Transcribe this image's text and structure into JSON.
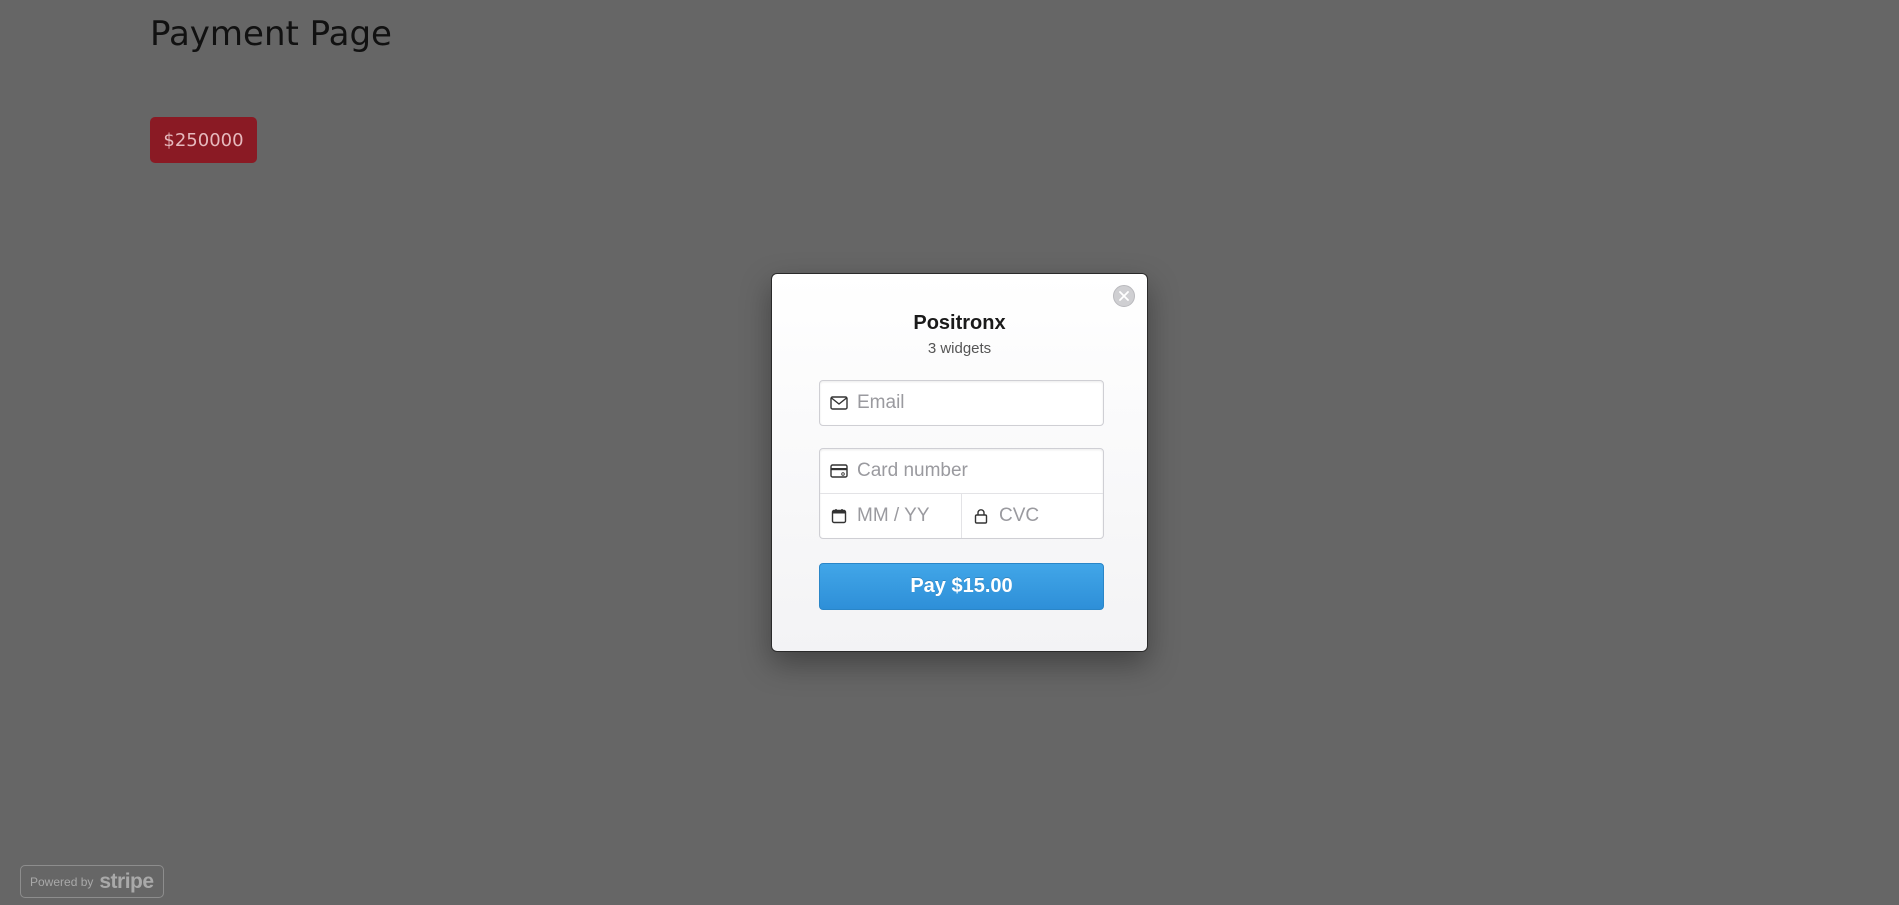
{
  "page": {
    "title": "Payment Page",
    "price_button_label": "$250000"
  },
  "checkout": {
    "merchant_name": "Positronx",
    "description": "3 widgets",
    "email_placeholder": "Email",
    "card_number_placeholder": "Card number",
    "expiry_placeholder": "MM / YY",
    "cvc_placeholder": "CVC",
    "pay_button_label": "Pay $15.00",
    "accent_color": "#3a9ee3"
  },
  "badge": {
    "powered_text": "Powered by",
    "brand_text": "stripe"
  },
  "icons": {
    "close": "close-icon",
    "email": "envelope-icon",
    "card": "credit-card-icon",
    "expiry": "calendar-icon",
    "cvc": "lock-icon"
  }
}
